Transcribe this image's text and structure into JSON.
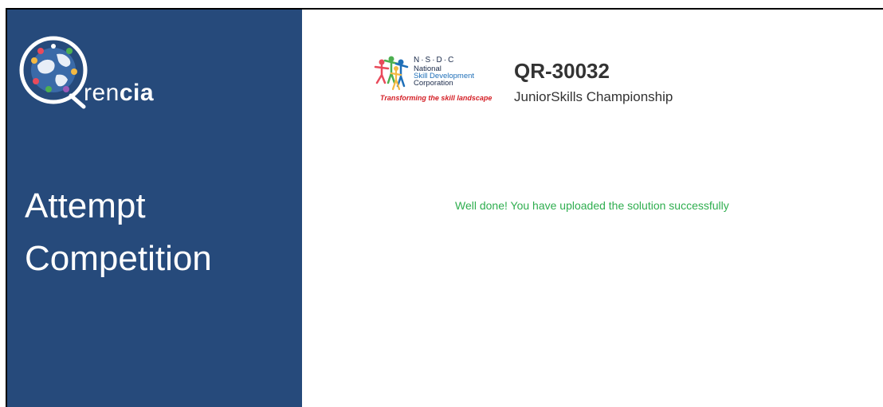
{
  "sidebar": {
    "brand_text_light": "ren",
    "brand_text_bold": "cia",
    "heading_line1": "Attempt",
    "heading_line2": "Competition"
  },
  "nsdc": {
    "abbrev": "N·S·D·C",
    "name_line1": "National",
    "name_line2": "Skill Development",
    "name_line3": "Corporation",
    "tagline": "Transforming the skill landscape"
  },
  "competition": {
    "code": "QR-30032",
    "name": "JuniorSkills Championship"
  },
  "status": {
    "message": "Well done! You have uploaded the solution successfully",
    "color": "#2fae4f"
  },
  "colors": {
    "sidebar_bg": "#264a7b",
    "accent_green": "#2fae4f",
    "nsdc_red": "#d42027",
    "nsdc_blue": "#1e6fb8"
  }
}
